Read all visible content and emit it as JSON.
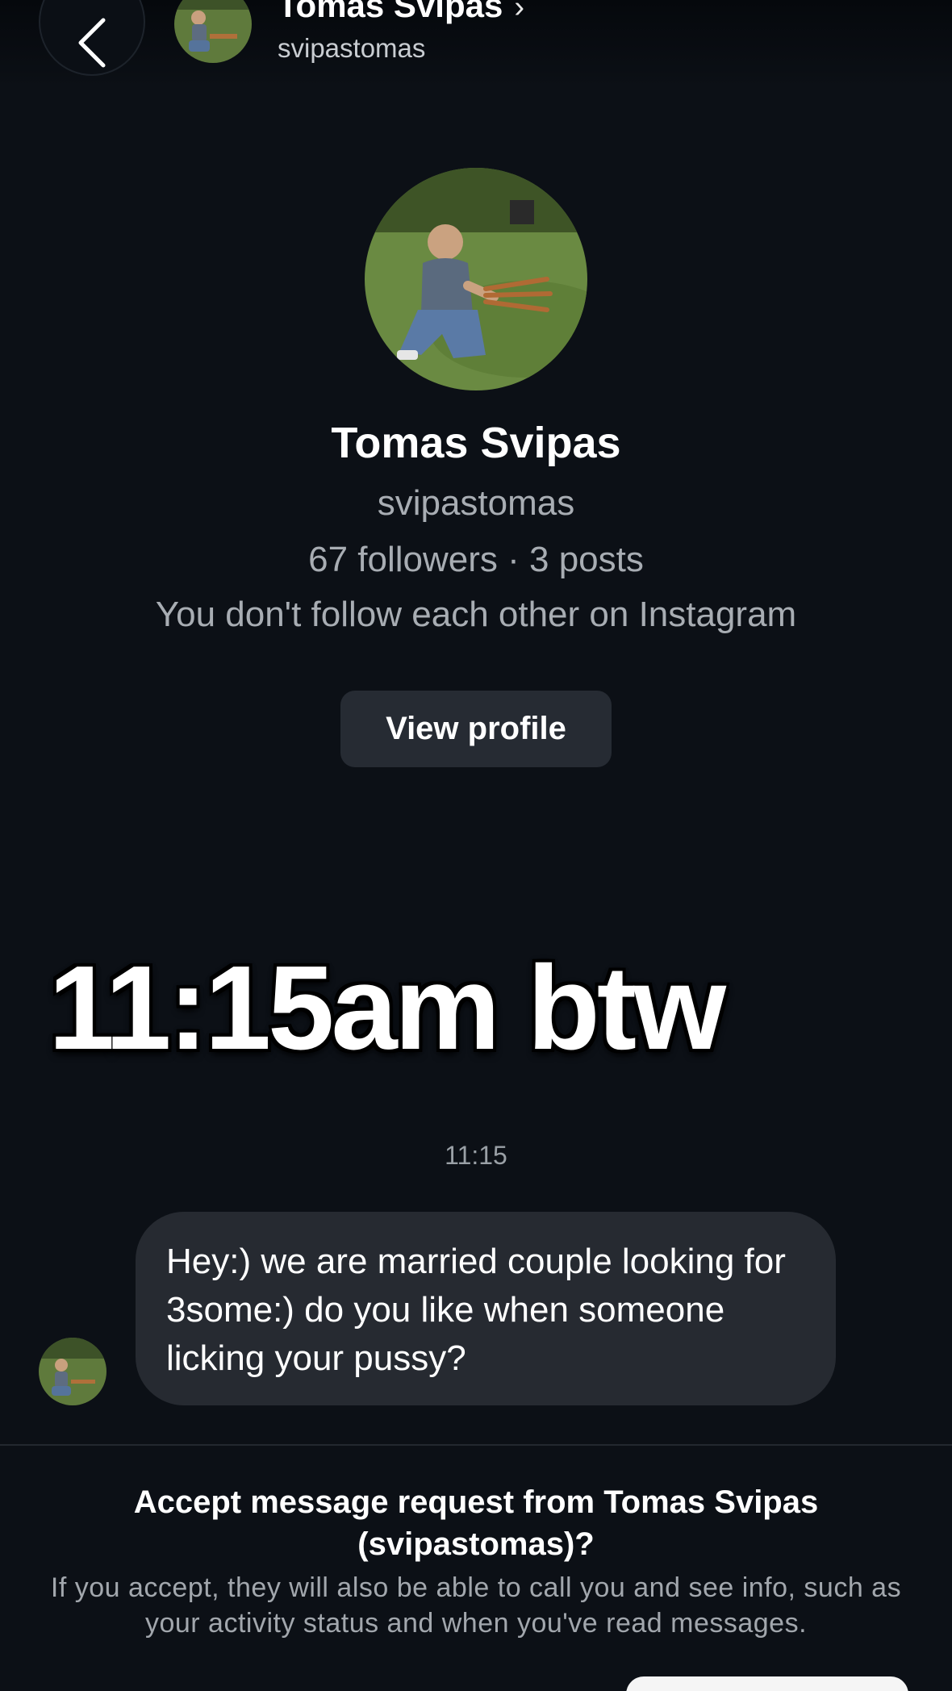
{
  "header": {
    "name": "Tomas Svipas",
    "chevron": "›",
    "username": "svipastomas"
  },
  "profile": {
    "name": "Tomas Svipas",
    "username": "svipastomas",
    "stats": "67 followers · 3 posts",
    "relationship": "You don't follow each other on Instagram",
    "view_profile_label": "View profile"
  },
  "overlay": {
    "caption": "11:15am btw"
  },
  "thread": {
    "timestamp": "11:15",
    "messages": [
      {
        "text": "Hey:) we are married couple looking for 3some:) do you like when someone licking your pussy?"
      }
    ]
  },
  "request": {
    "title": "Accept message request from Tomas Svipas (svipastomas)?",
    "body": "If you accept, they will also be able to call you and see info, such as your activity status and when you've read messages."
  },
  "icons": {
    "back": "chevron-left-icon",
    "header_chevron": "chevron-right-icon",
    "avatar": "avatar-photo"
  },
  "colors": {
    "background": "#0c1016",
    "bubble": "#262a31",
    "button": "#262b33",
    "secondary_text": "#a8adb3"
  }
}
